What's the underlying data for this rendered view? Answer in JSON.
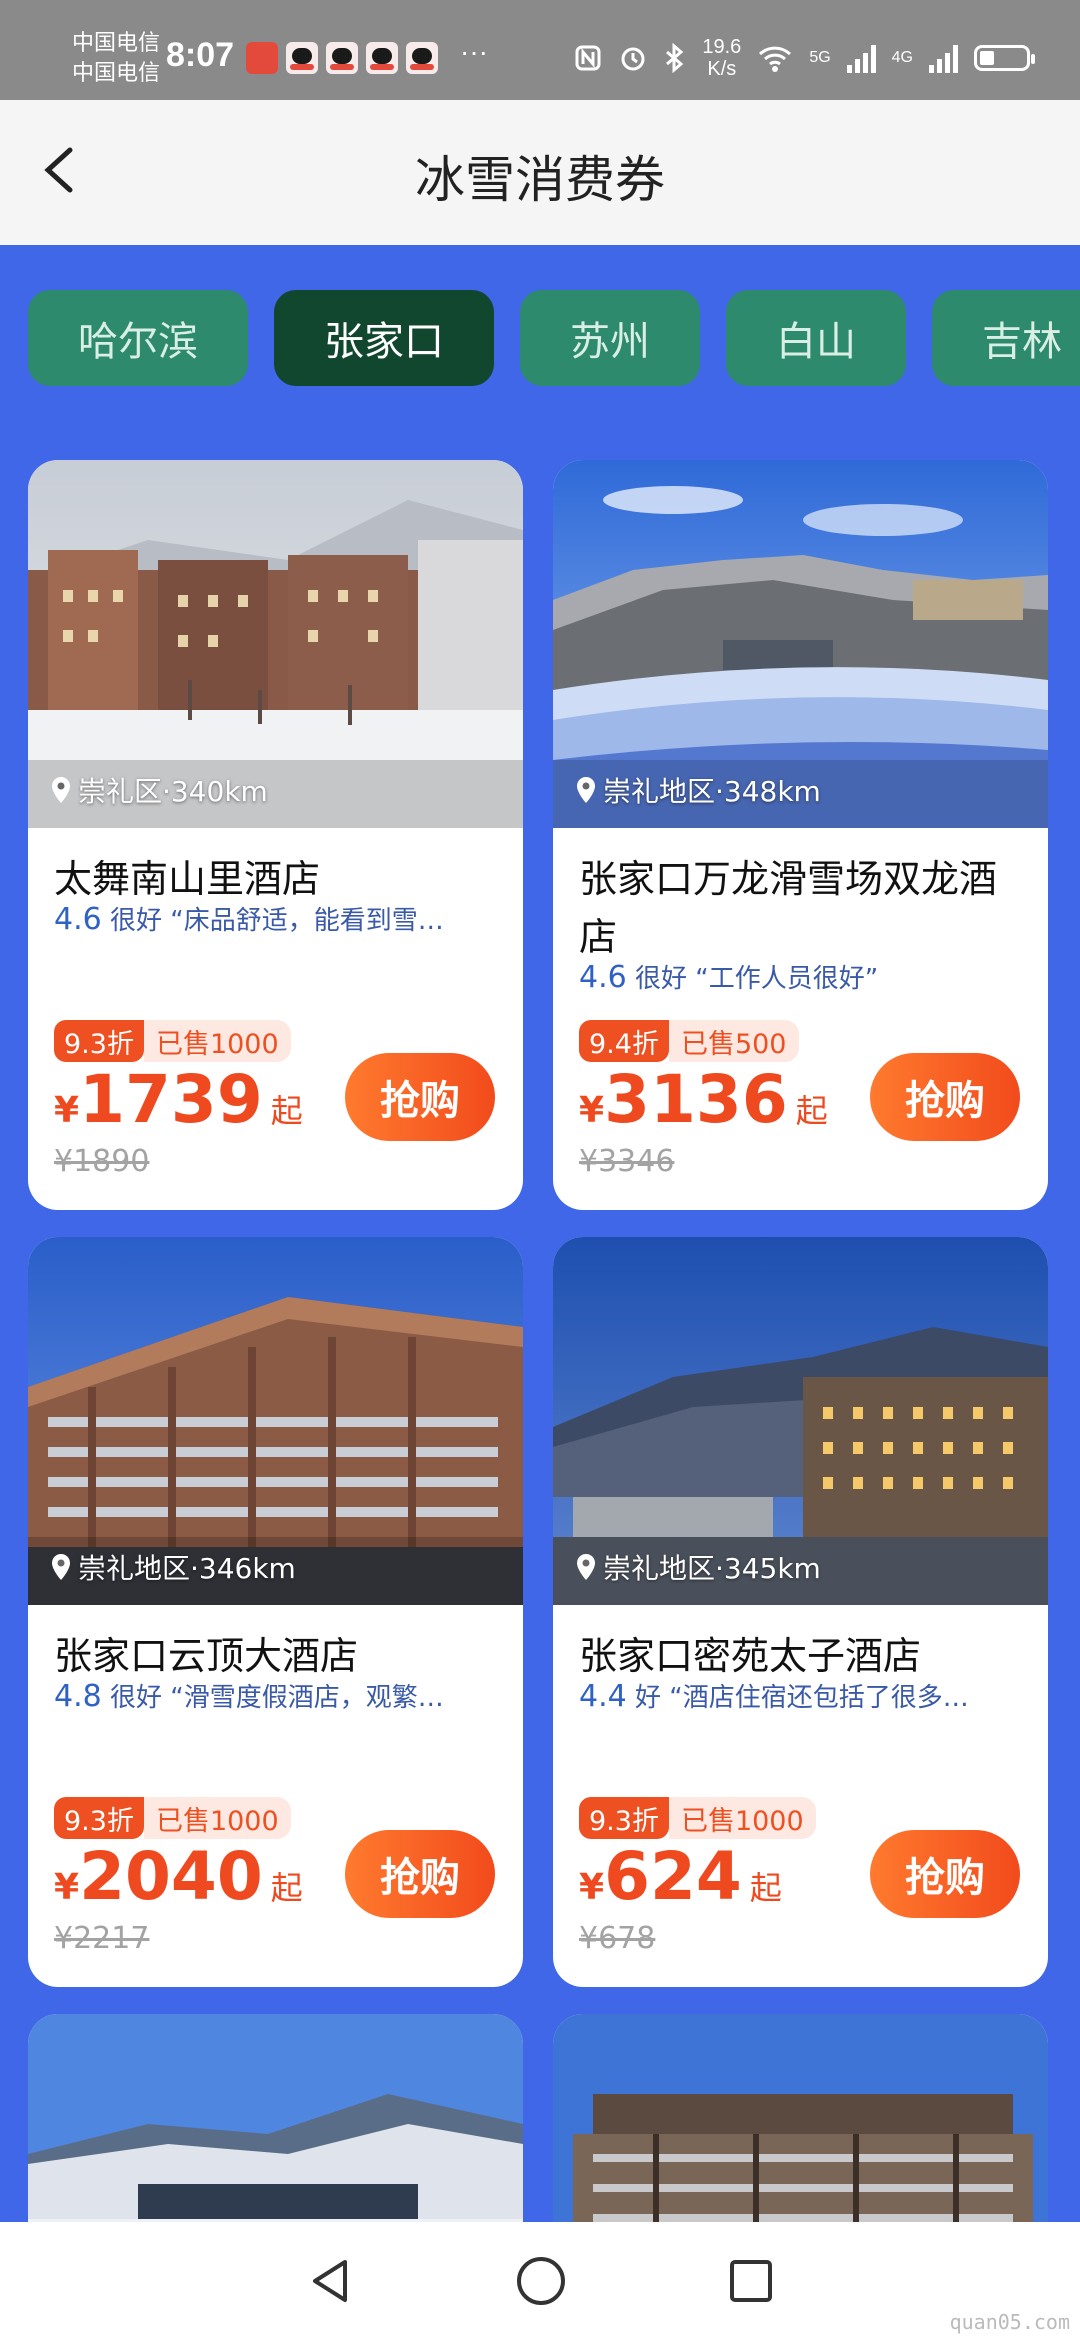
{
  "status_bar": {
    "carrier_1": "中国电信",
    "carrier_2": "中国电信",
    "time": "8:07",
    "speed": "19.6",
    "speed_unit": "K/s",
    "net_5g": "5G",
    "net_4g": "4G",
    "more": "···"
  },
  "header": {
    "title": "冰雪消费券"
  },
  "tabs": [
    {
      "label": "哈尔滨"
    },
    {
      "label": "张家口",
      "active": true
    },
    {
      "label": "苏州"
    },
    {
      "label": "白山"
    },
    {
      "label": "吉林"
    }
  ],
  "cards": [
    {
      "location": "崇礼区·340km",
      "name": "太舞南山里酒店",
      "score": "4.6",
      "rating_text": "很好 “床品舒适，能看到雪…",
      "discount": "9.3折",
      "sold": "已售1000",
      "currency": "¥",
      "price": "1739",
      "suffix": "起",
      "original_price": "¥1890",
      "buy_label": "抢购"
    },
    {
      "location": "崇礼地区·348km",
      "name": "张家口万龙滑雪场双龙酒店",
      "score": "4.6",
      "rating_text": "很好 “工作人员很好”",
      "discount": "9.4折",
      "sold": "已售500",
      "currency": "¥",
      "price": "3136",
      "suffix": "起",
      "original_price": "¥3346",
      "buy_label": "抢购"
    },
    {
      "location": "崇礼地区·346km",
      "name": "张家口云顶大酒店",
      "score": "4.8",
      "rating_text": "很好 “滑雪度假酒店，观繁…",
      "discount": "9.3折",
      "sold": "已售1000",
      "currency": "¥",
      "price": "2040",
      "suffix": "起",
      "original_price": "¥2217",
      "buy_label": "抢购"
    },
    {
      "location": "崇礼地区·345km",
      "name": "张家口密苑太子酒店",
      "score": "4.4",
      "rating_text": "好 “酒店住宿还包括了很多…",
      "discount": "9.3折",
      "sold": "已售1000",
      "currency": "¥",
      "price": "624",
      "suffix": "起",
      "original_price": "¥678",
      "buy_label": "抢购"
    }
  ],
  "watermark": "quan05.com"
}
